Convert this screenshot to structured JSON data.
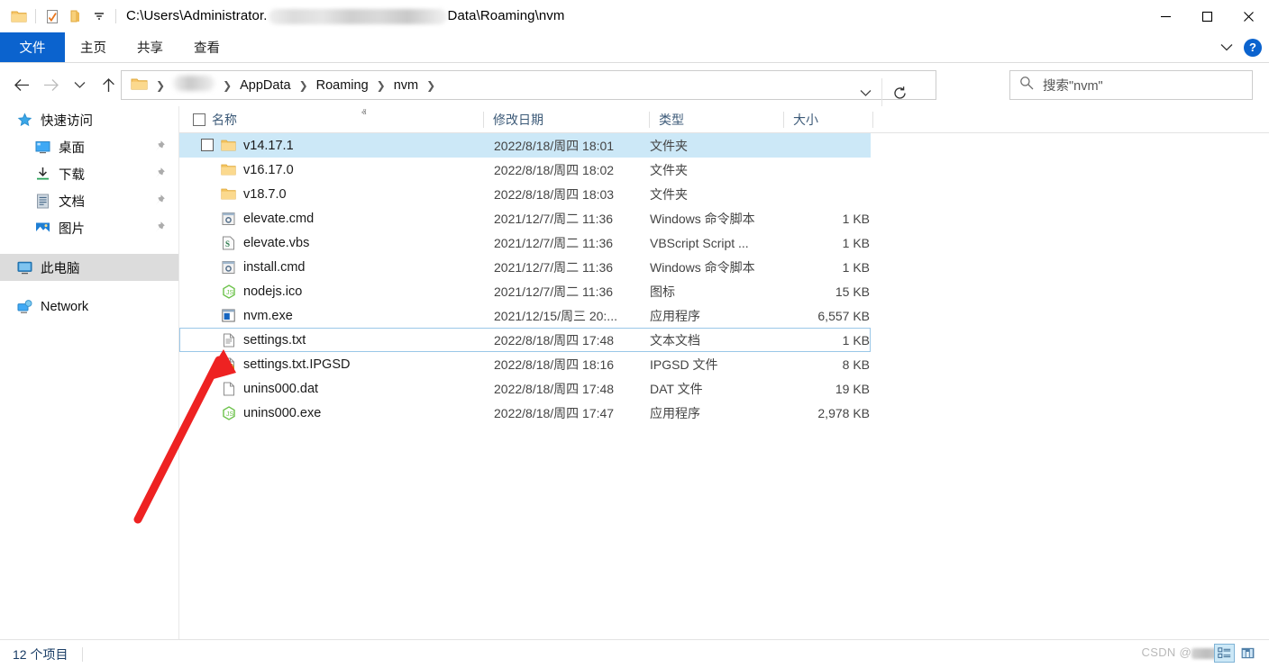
{
  "window": {
    "title_prefix": "C:\\Users\\Administrator.",
    "title_suffix": "Data\\Roaming\\nvm",
    "minimize_label": "—",
    "maximize_label": "□",
    "close_label": "✕"
  },
  "quick_access_toolbar": {
    "folder_icon": "folder-icon",
    "properties_icon": "properties-icon",
    "new_folder_icon": "new-folder-icon",
    "dropdown_icon": "chevron-down-icon"
  },
  "ribbon": {
    "tabs": [
      {
        "label": "文件",
        "active": true
      },
      {
        "label": "主页",
        "active": false
      },
      {
        "label": "共享",
        "active": false
      },
      {
        "label": "查看",
        "active": false
      }
    ],
    "expand_icon": "chevron-down-icon",
    "help_label": "?"
  },
  "address_bar": {
    "back_icon": "arrow-left-icon",
    "forward_icon": "arrow-right-icon",
    "recent_icon": "chevron-down-icon",
    "up_icon": "arrow-up-icon",
    "breadcrumbs": [
      {
        "label": "",
        "type": "folder-icon"
      },
      {
        "label": "",
        "type": "redacted"
      },
      {
        "label": "AppData",
        "type": "text"
      },
      {
        "label": "Roaming",
        "type": "text"
      },
      {
        "label": "nvm",
        "type": "text"
      }
    ],
    "dropdown_icon": "chevron-down-icon",
    "refresh_icon": "refresh-icon"
  },
  "search": {
    "icon": "search-icon",
    "placeholder": "搜索\"nvm\""
  },
  "sidebar": {
    "items": [
      {
        "label": "快速访问",
        "icon": "star-icon",
        "indent": false,
        "pinned": false,
        "selected": false
      },
      {
        "label": "桌面",
        "icon": "desktop-icon",
        "indent": true,
        "pinned": true,
        "selected": false
      },
      {
        "label": "下载",
        "icon": "downloads-icon",
        "indent": true,
        "pinned": true,
        "selected": false
      },
      {
        "label": "文档",
        "icon": "documents-icon",
        "indent": true,
        "pinned": true,
        "selected": false
      },
      {
        "label": "图片",
        "icon": "pictures-icon",
        "indent": true,
        "pinned": true,
        "selected": false
      },
      {
        "label": "此电脑",
        "icon": "this-pc-icon",
        "indent": false,
        "pinned": false,
        "selected": true
      },
      {
        "label": "Network",
        "icon": "network-icon",
        "indent": false,
        "pinned": false,
        "selected": false
      }
    ]
  },
  "file_list": {
    "columns": [
      {
        "label": "名称",
        "sorted": "asc"
      },
      {
        "label": "修改日期",
        "sorted": ""
      },
      {
        "label": "类型",
        "sorted": ""
      },
      {
        "label": "大小",
        "sorted": ""
      }
    ],
    "sort_caret": "ⱏ",
    "rows": [
      {
        "name": "v14.17.1",
        "date": "2022/8/18/周四 18:01",
        "type": "文件夹",
        "size": "",
        "icon": "folder-icon",
        "state": "hovered",
        "checkbox": true
      },
      {
        "name": "v16.17.0",
        "date": "2022/8/18/周四 18:02",
        "type": "文件夹",
        "size": "",
        "icon": "folder-icon",
        "state": "",
        "checkbox": false
      },
      {
        "name": "v18.7.0",
        "date": "2022/8/18/周四 18:03",
        "type": "文件夹",
        "size": "",
        "icon": "folder-icon",
        "state": "",
        "checkbox": false
      },
      {
        "name": "elevate.cmd",
        "date": "2021/12/7/周二 11:36",
        "type": "Windows 命令脚本",
        "size": "1 KB",
        "icon": "cmd-icon",
        "state": "",
        "checkbox": false
      },
      {
        "name": "elevate.vbs",
        "date": "2021/12/7/周二 11:36",
        "type": "VBScript Script ...",
        "size": "1 KB",
        "icon": "vbs-icon",
        "state": "",
        "checkbox": false
      },
      {
        "name": "install.cmd",
        "date": "2021/12/7/周二 11:36",
        "type": "Windows 命令脚本",
        "size": "1 KB",
        "icon": "cmd-icon",
        "state": "",
        "checkbox": false
      },
      {
        "name": "nodejs.ico",
        "date": "2021/12/7/周二 11:36",
        "type": "图标",
        "size": "15 KB",
        "icon": "nodejs-icon",
        "state": "",
        "checkbox": false
      },
      {
        "name": "nvm.exe",
        "date": "2021/12/15/周三 20:...",
        "type": "应用程序",
        "size": "6,557 KB",
        "icon": "exe-icon",
        "state": "",
        "checkbox": false
      },
      {
        "name": "settings.txt",
        "date": "2022/8/18/周四 17:48",
        "type": "文本文档",
        "size": "1 KB",
        "icon": "txt-icon",
        "state": "focused",
        "checkbox": false
      },
      {
        "name": "settings.txt.IPGSD",
        "date": "2022/8/18/周四 18:16",
        "type": "IPGSD 文件",
        "size": "8 KB",
        "icon": "locked-file-icon",
        "state": "",
        "checkbox": false
      },
      {
        "name": "unins000.dat",
        "date": "2022/8/18/周四 17:48",
        "type": "DAT 文件",
        "size": "19 KB",
        "icon": "blank-file-icon",
        "state": "",
        "checkbox": false
      },
      {
        "name": "unins000.exe",
        "date": "2022/8/18/周四 17:47",
        "type": "应用程序",
        "size": "2,978 KB",
        "icon": "nodejs-icon",
        "state": "",
        "checkbox": false
      }
    ]
  },
  "status_bar": {
    "item_count": "12 个项目",
    "details_view_icon": "details-view-icon",
    "large_icons_view_icon": "large-icons-view-icon"
  },
  "watermark": {
    "text": "CSDN @"
  },
  "annotation": {
    "type": "red-arrow",
    "points_to": "settings.txt",
    "color": "#ee2222"
  },
  "colors": {
    "accent": "#0b63ce",
    "selection": "#cce8f7",
    "focus_outline": "#9ac7e8",
    "sidebar_selected": "#dcdcdc",
    "header_text": "#3c5a78",
    "annotation_red": "#ee2222"
  }
}
